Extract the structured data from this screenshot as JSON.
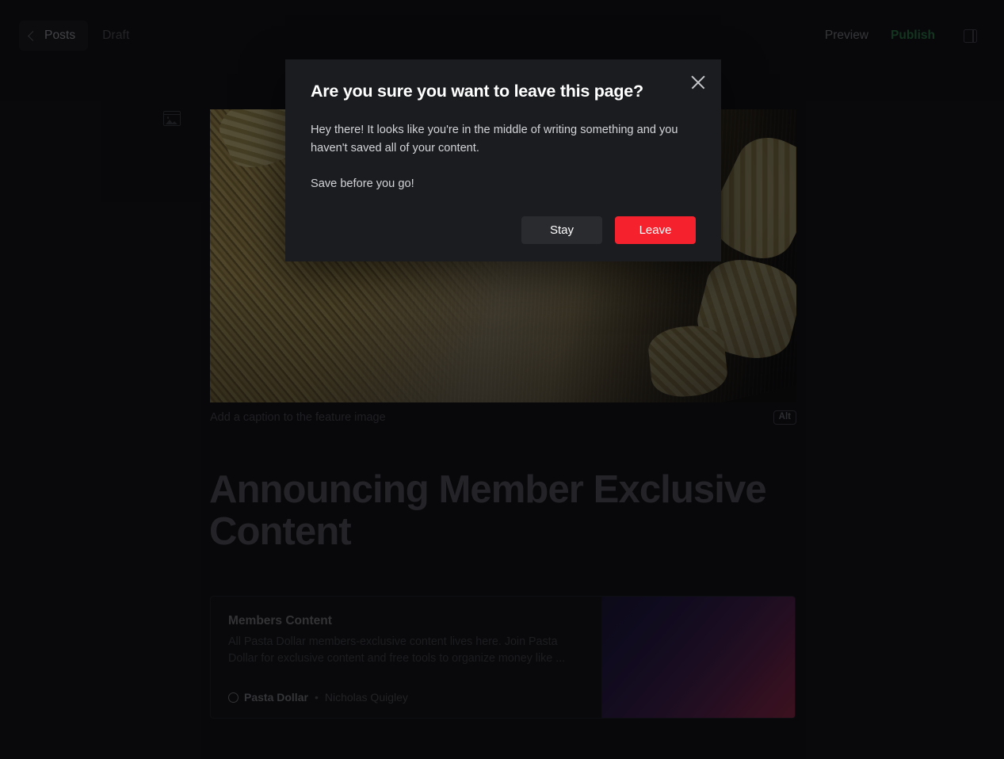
{
  "header": {
    "back_button_label": "Posts",
    "back_icon": "chevron-left-icon",
    "status_label": "Draft",
    "preview_label": "Preview",
    "publish_label": "Publish",
    "publish_color": "#2a8a47",
    "sidebar_toggle_icon": "sidebar-panel-icon"
  },
  "editor": {
    "feature_image_icon": "image-placeholder-icon",
    "feature_image_alt_description": "Dried spaghetti and fusilli pasta on a wooden cutting board",
    "caption_placeholder": "Add a caption to the feature image",
    "alt_badge_label": "Alt",
    "post_title": "Announcing Member Exclusive Content",
    "bookmark_card": {
      "title": "Members Content",
      "description": "All Pasta Dollar members-exclusive content lives here. Join Pasta Dollar for exclusive content and free tools to organize money like ...",
      "publisher_icon": "site-favicon-circle-icon",
      "publisher": "Pasta Dollar",
      "separator": "•",
      "author": "Nicholas Quigley",
      "thumbnail_gradient_from": "#171036",
      "thumbnail_gradient_to": "#9e2545"
    }
  },
  "modal": {
    "title": "Are you sure you want to leave this page?",
    "body_paragraph_1": "Hey there! It looks like you're in the middle of writing something and you haven't saved all of your content.",
    "body_paragraph_2": "Save before you go!",
    "close_icon": "close-x-icon",
    "stay_label": "Stay",
    "leave_label": "Leave",
    "stay_color": "#2a2b2f",
    "leave_color": "#f5222d"
  }
}
